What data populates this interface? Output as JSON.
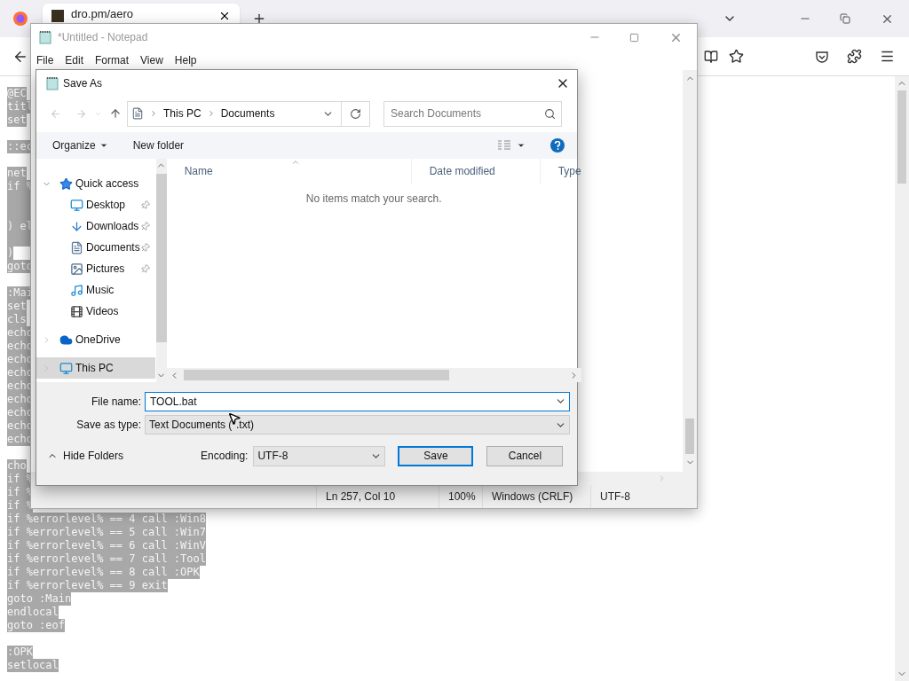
{
  "browser": {
    "tabs": [
      {
        "title": "dro.pm/aero",
        "selected": true
      }
    ],
    "page_lines": [
      {
        "kind": "text",
        "text": "@EC"
      },
      {
        "kind": "text",
        "text": "titl"
      },
      {
        "kind": "text",
        "text": "set"
      },
      {
        "kind": "blank"
      },
      {
        "kind": "text",
        "text": "::ec"
      },
      {
        "kind": "blank"
      },
      {
        "kind": "text",
        "text": "net"
      },
      {
        "kind": "text",
        "text": "if %"
      },
      {
        "kind": "selected-blank"
      },
      {
        "kind": "selected-blank"
      },
      {
        "kind": "text",
        "text": ") el"
      },
      {
        "kind": "selected-blank"
      },
      {
        "kind": "text",
        "text": ")"
      },
      {
        "kind": "text",
        "text": "goto"
      },
      {
        "kind": "blank"
      },
      {
        "kind": "text",
        "text": ":Mai"
      },
      {
        "kind": "text",
        "text": "set"
      },
      {
        "kind": "text",
        "text": "cls"
      },
      {
        "kind": "text",
        "text": "echo"
      },
      {
        "kind": "text",
        "text": "echo"
      },
      {
        "kind": "text",
        "text": "echo"
      },
      {
        "kind": "text",
        "text": "echo"
      },
      {
        "kind": "text",
        "text": "echo"
      },
      {
        "kind": "text",
        "text": "echo"
      },
      {
        "kind": "text",
        "text": "echo"
      },
      {
        "kind": "text",
        "text": "echo"
      },
      {
        "kind": "text",
        "text": "echo"
      },
      {
        "kind": "blank"
      },
      {
        "kind": "text",
        "text": "cho"
      },
      {
        "kind": "text",
        "text": "if %"
      },
      {
        "kind": "text",
        "text": "if %"
      },
      {
        "kind": "text",
        "text": "if %"
      },
      {
        "kind": "text",
        "text": "if %errorlevel% == 4 call :Win8"
      },
      {
        "kind": "text",
        "text": "if %errorlevel% == 5 call :Win7"
      },
      {
        "kind": "text",
        "text": "if %errorlevel% == 6 call :WinV"
      },
      {
        "kind": "text",
        "text": "if %errorlevel% == 7 call :Tool"
      },
      {
        "kind": "text",
        "text": "if %errorlevel% == 8 call :OPK"
      },
      {
        "kind": "text",
        "text": "if %errorlevel% == 9 exit"
      },
      {
        "kind": "text",
        "text": "goto :Main"
      },
      {
        "kind": "text",
        "text": "endlocal"
      },
      {
        "kind": "text",
        "text": "goto :eof"
      },
      {
        "kind": "blank"
      },
      {
        "kind": "text",
        "text": ":OPK"
      },
      {
        "kind": "text",
        "text": "setlocal"
      }
    ]
  },
  "notepad": {
    "title": "*Untitled - Notepad",
    "menu": [
      "File",
      "Edit",
      "Format",
      "View",
      "Help"
    ],
    "status": [
      "Ln 257, Col 10",
      "100%",
      "Windows (CRLF)",
      "UTF-8"
    ]
  },
  "save_dialog": {
    "title": "Save As",
    "breadcrumb": [
      "This PC",
      "Documents"
    ],
    "search": {
      "placeholder": "Search Documents"
    },
    "toolbar": {
      "organize": "Organize",
      "new_folder": "New folder"
    },
    "nav": [
      {
        "label": "Quick access",
        "expanded": true,
        "selected": false,
        "children": [
          {
            "label": "Desktop",
            "pinned": true,
            "selected": false
          },
          {
            "label": "Downloads",
            "pinned": true,
            "selected": false
          },
          {
            "label": "Documents",
            "pinned": true,
            "selected": false
          },
          {
            "label": "Pictures",
            "pinned": true,
            "selected": false
          },
          {
            "label": "Music",
            "pinned": false,
            "selected": false
          },
          {
            "label": "Videos",
            "pinned": false,
            "selected": false
          }
        ]
      },
      {
        "label": "OneDrive",
        "expanded": false,
        "selected": false
      },
      {
        "label": "This PC",
        "expanded": false,
        "selected": true
      }
    ],
    "columns": [
      {
        "label": "Name",
        "sorted": true
      },
      {
        "label": "Date modified",
        "sorted": false
      },
      {
        "label": "Type",
        "sorted": false
      }
    ],
    "empty_message": "No items match your search.",
    "file_name": {
      "label": "File name:",
      "value": "TOOL.bat"
    },
    "save_type": {
      "label": "Save as type:",
      "value": "Text Documents (*.txt)"
    },
    "hide_folders": "Hide Folders",
    "encoding": {
      "label": "Encoding:",
      "value": "UTF-8"
    },
    "buttons": {
      "save": "Save",
      "cancel": "Cancel"
    }
  }
}
